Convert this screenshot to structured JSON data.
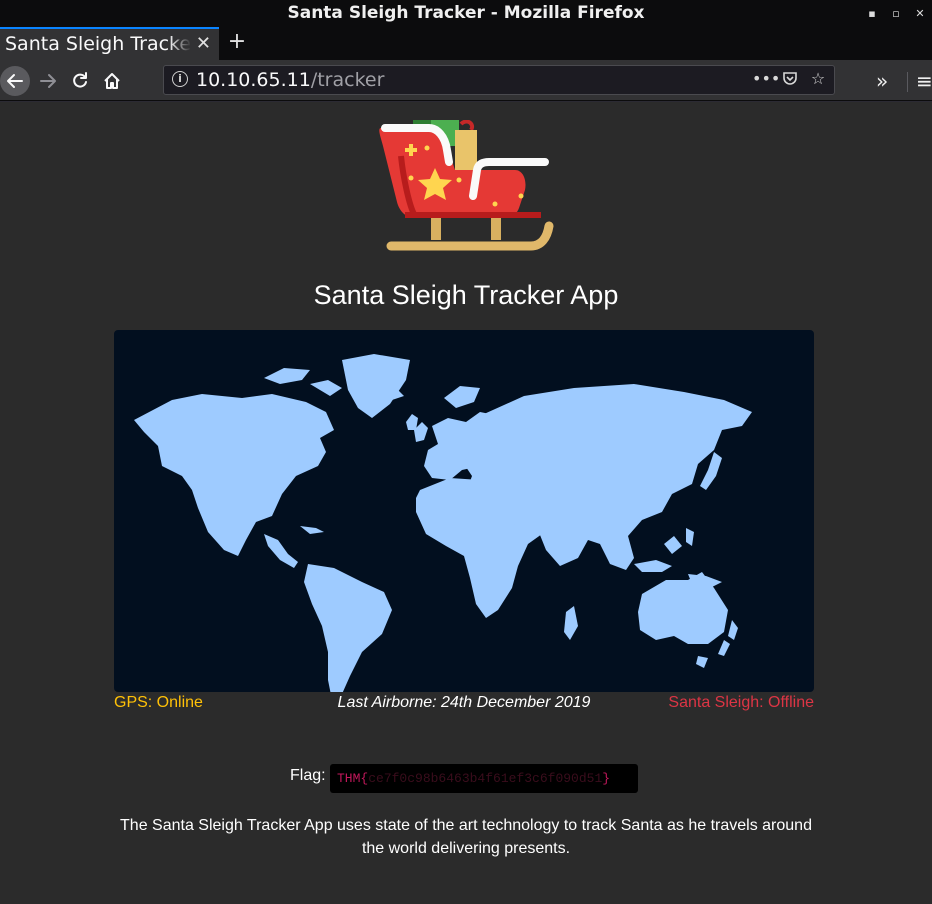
{
  "window": {
    "title": "Santa Sleigh Tracker - Mozilla Firefox"
  },
  "tab": {
    "label": "Santa Sleigh Tracker",
    "close": "✕",
    "new_tab": "+"
  },
  "urlbar": {
    "host": "10.10.65.11",
    "path": "/tracker"
  },
  "page": {
    "heading": "Santa Sleigh Tracker App",
    "gps_status": "GPS: Online",
    "last_airborne": "Last Airborne: 24th December 2019",
    "sleigh_status": "Santa Sleigh: Offline",
    "flag_label": "Flag:",
    "flag_prefix": "THM{",
    "flag_redacted": "ce7f0c98b6463b4f61ef3c6f090d51",
    "flag_suffix": "}",
    "description": "The Santa Sleigh Tracker App uses state of the art technology to track Santa as he travels around the world delivering presents."
  },
  "colors": {
    "gps": "#ffc107",
    "offline": "#dc3545",
    "map_bg": "#020f1f",
    "land": "#9ecbff"
  }
}
